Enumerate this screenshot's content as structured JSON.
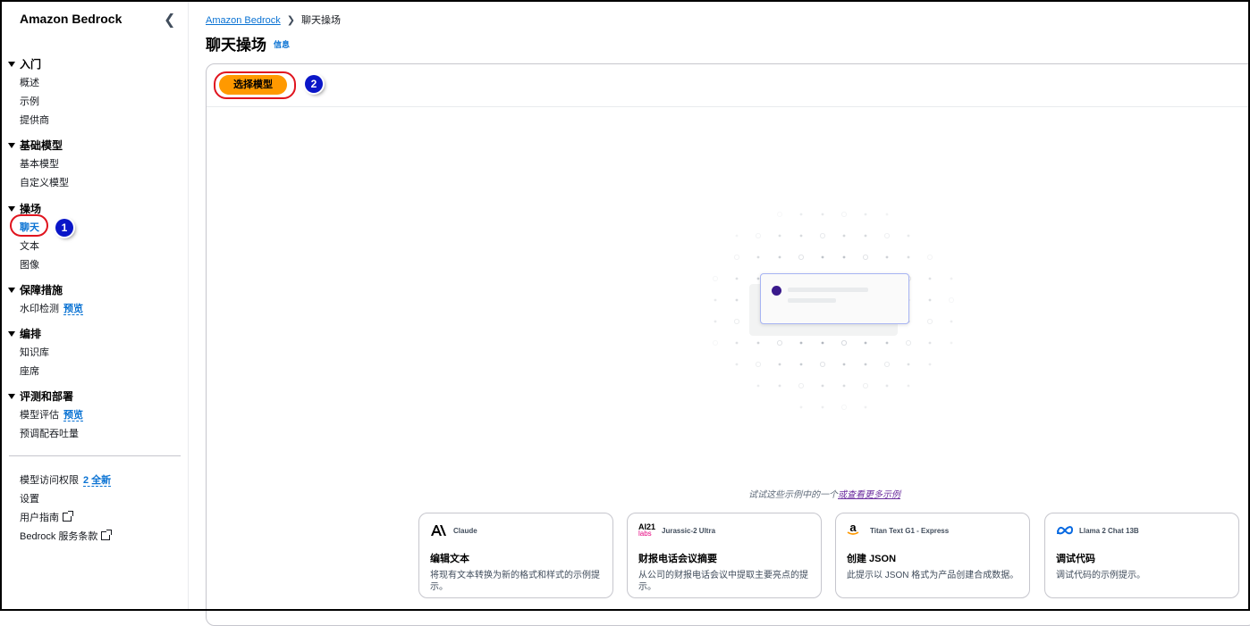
{
  "sidebar": {
    "title": "Amazon Bedrock",
    "groups": [
      {
        "title": "入门",
        "items": [
          "概述",
          "示例",
          "提供商"
        ]
      },
      {
        "title": "基础模型",
        "items": [
          "基本模型",
          "自定义模型"
        ]
      },
      {
        "title": "操场",
        "items": [
          "聊天",
          "文本",
          "图像"
        ]
      },
      {
        "title": "保障措施",
        "items": [
          "水印检测"
        ]
      },
      {
        "title": "编排",
        "items": [
          "知识库",
          "座席"
        ]
      },
      {
        "title": "评测和部署",
        "items": [
          "模型评估",
          "预调配吞吐量"
        ]
      }
    ],
    "preview_label": "预览",
    "footer": {
      "model_access": "模型访问权限",
      "model_access_new": "2 全新",
      "settings": "设置",
      "user_guide": "用户指南",
      "terms": "Bedrock 服务条款"
    }
  },
  "breadcrumb": {
    "root": "Amazon Bedrock",
    "current": "聊天操场"
  },
  "page": {
    "title": "聊天操场",
    "info": "信息"
  },
  "toolbar": {
    "select_model": "选择模型"
  },
  "annotations": {
    "step1": "1",
    "step2": "2"
  },
  "examples": {
    "hint": "试试这些示例中的一个",
    "hint_link": "或查看更多示例",
    "cards": [
      {
        "model": "Claude",
        "logo": "anthropic-logo-icon",
        "title": "编辑文本",
        "desc": "将现有文本转换为新的格式和样式的示例提示。"
      },
      {
        "model": "Jurassic-2 Ultra",
        "logo": "ai21-labs-logo-icon",
        "logo_text_top": "AI21",
        "logo_text_bottom": "labs",
        "title": "财报电话会议摘要",
        "desc": "从公司的财报电话会议中提取主要亮点的提示。"
      },
      {
        "model": "Titan Text G1 - Express",
        "logo": "amazon-logo-icon",
        "logo_text": "a",
        "title": "创建 JSON",
        "desc": "此提示以 JSON 格式为产品创建合成数据。"
      },
      {
        "model": "Llama 2 Chat 13B",
        "logo": "meta-logo-icon",
        "title": "调试代码",
        "desc": "调试代码的示例提示。"
      }
    ]
  },
  "colors": {
    "accent": "#0972d3",
    "primary_button": "#ff9900",
    "annotation_red": "#e0141e",
    "badge_blue": "#0a16c8"
  }
}
